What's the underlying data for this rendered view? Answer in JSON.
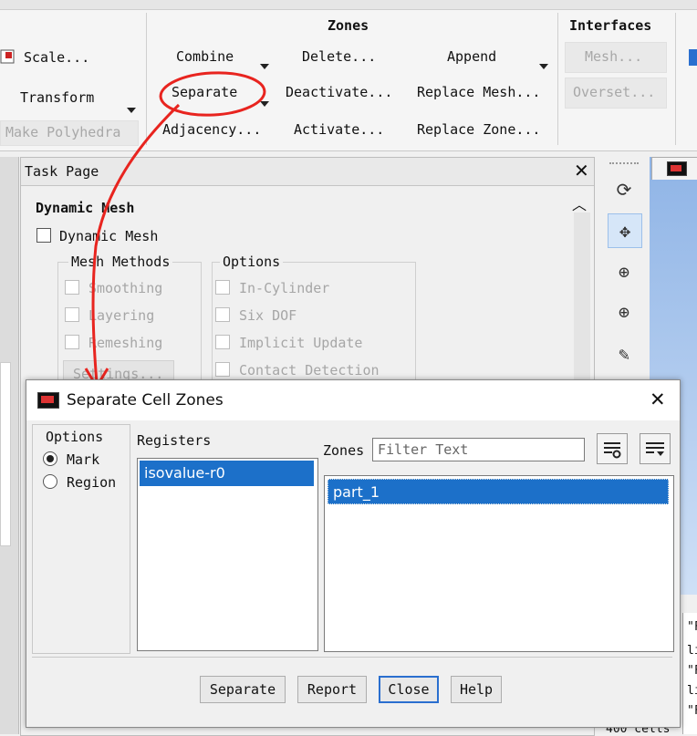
{
  "ribbon": {
    "scale_label": "Scale...",
    "transform_label": "Transform",
    "make_polyhedra_label": "Make Polyhedra",
    "zones_title": "Zones",
    "combine_label": "Combine",
    "delete_label": "Delete...",
    "append_label": "Append",
    "separate_label": "Separate",
    "deactivate_label": "Deactivate...",
    "replace_mesh_label": "Replace Mesh...",
    "adjacency_label": "Adjacency...",
    "activate_label": "Activate...",
    "replace_zone_label": "Replace Zone...",
    "interfaces_title": "Interfaces",
    "mesh_label": "Mesh...",
    "overset_label": "Overset..."
  },
  "task_page": {
    "title": "Task Page",
    "section_title": "Dynamic Mesh",
    "dynamic_mesh_label": "Dynamic Mesh",
    "mesh_methods_title": "Mesh Methods",
    "smoothing_label": "Smoothing",
    "layering_label": "Layering",
    "remeshing_label": "Remeshing",
    "settings_label": "Settings...",
    "options_title": "Options",
    "in_cylinder_label": "In-Cylinder",
    "six_dof_label": "Six DOF",
    "implicit_update_label": "Implicit Update",
    "contact_detection_label": "Contact Detection"
  },
  "dialog": {
    "title": "Separate Cell Zones",
    "options_title": "Options",
    "mark_label": "Mark",
    "region_label": "Region",
    "selected_option": "Mark",
    "registers_title": "Registers",
    "registers": [
      "isovalue-r0"
    ],
    "zones_title": "Zones",
    "filter_placeholder": "Filter Text",
    "zones": [
      "part_1"
    ],
    "separate_button": "Separate",
    "report_button": "Report",
    "close_button": "Close",
    "help_button": "Help"
  },
  "console": {
    "lines": [
      "\"F",
      "li",
      "\"F",
      "li",
      "\"F"
    ],
    "bottom_text": "400 cells"
  },
  "colors": {
    "selection": "#1c70c9",
    "annotation": "#e8241f",
    "graphics_bg": "#8fb4e6"
  }
}
